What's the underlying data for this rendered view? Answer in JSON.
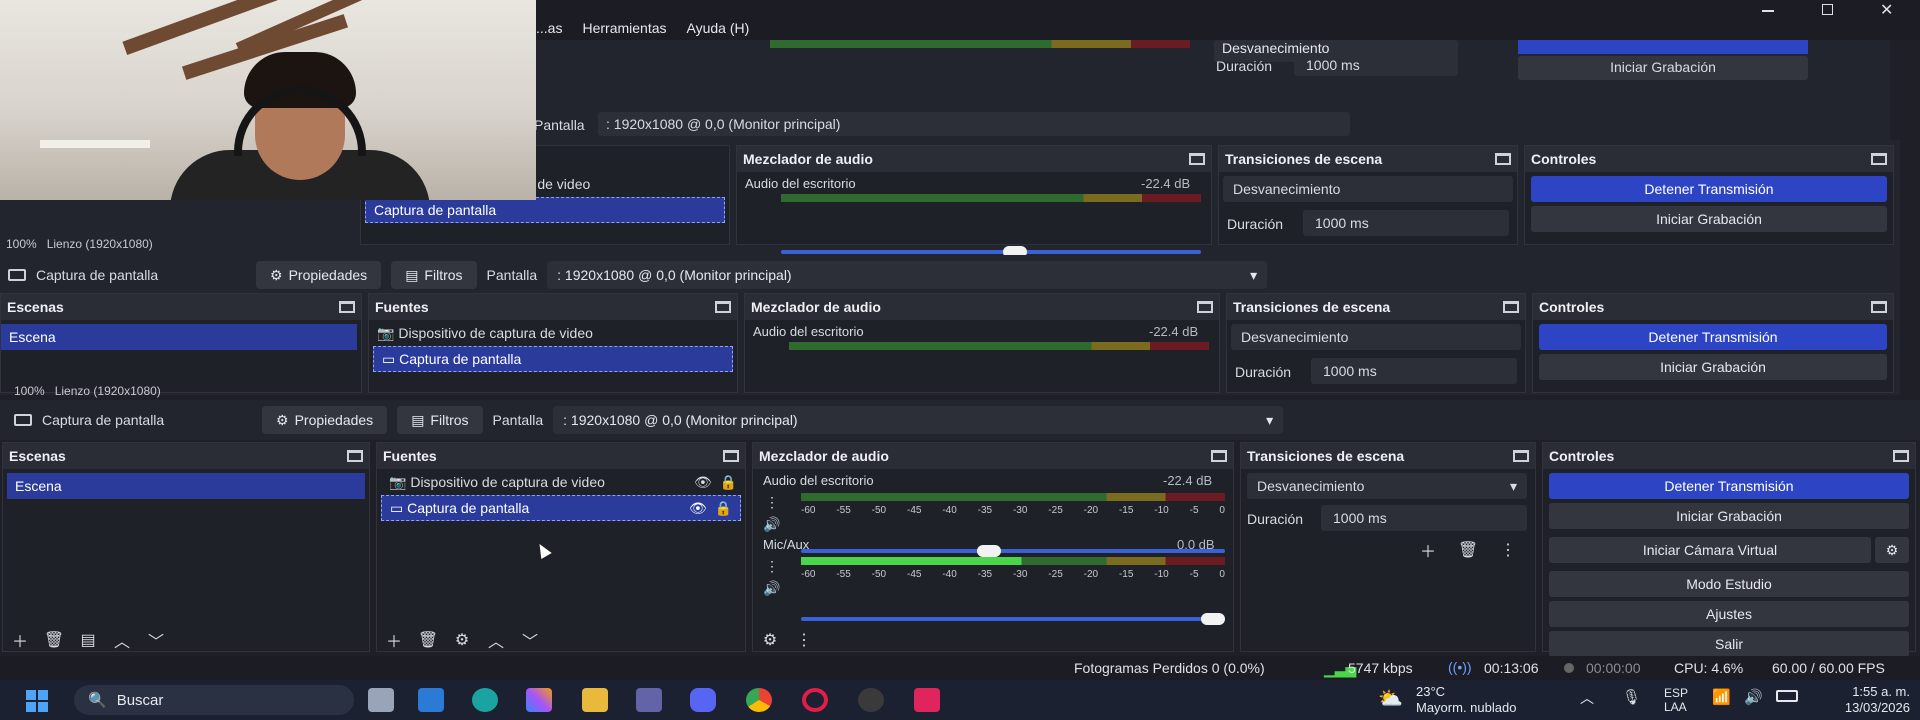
{
  "menu": {
    "items": [
      "...as",
      "Herramientas",
      "Ayuda (H)"
    ]
  },
  "source_toolbar": {
    "source_name": "Captura de pantalla",
    "properties": "Propiedades",
    "filters": "Filtros",
    "display_label": "Pantalla",
    "display_value": ": 1920x1080 @ 0,0 (Monitor principal)"
  },
  "preview": {
    "zoom": "100%",
    "canvas": "Lienzo (1920x1080)"
  },
  "scenes": {
    "title": "Escenas",
    "items": [
      "Escena"
    ]
  },
  "sources": {
    "title": "Fuentes",
    "items": [
      "Dispositivo de captura de video",
      "Captura de pantalla"
    ],
    "partial_item": "ra de video"
  },
  "mixer": {
    "title": "Mezclador de audio",
    "channels": [
      {
        "name": "Audio del escritorio",
        "db": "-22.4 dB"
      },
      {
        "name": "Mic/Aux",
        "db": "0.0 dB"
      }
    ],
    "scale": [
      "-60",
      "-55",
      "-50",
      "-45",
      "-40",
      "-35",
      "-30",
      "-25",
      "-20",
      "-15",
      "-10",
      "-5",
      "0"
    ]
  },
  "transitions": {
    "title": "Transiciones de escena",
    "selected": "Desvanecimiento",
    "duration_label": "Duración",
    "duration_value": "1000 ms"
  },
  "controls": {
    "title": "Controles",
    "buttons": [
      "Detener Transmisión",
      "Iniciar Grabación",
      "Iniciar Cámara Virtual",
      "Modo Estudio",
      "Ajustes",
      "Salir"
    ]
  },
  "statusbar": {
    "dropped": "Fotogramas Perdidos 0 (0.0%)",
    "bitrate": "5747 kbps",
    "stream_time": "00:13:06",
    "rec_time": "00:00:00",
    "cpu": "CPU: 4.6%",
    "fps": "60.00 / 60.00 FPS"
  },
  "taskbar": {
    "search": "Buscar",
    "weather_temp": "23°C",
    "weather_desc": "Mayorm. nublado",
    "lang_top": "ESP",
    "lang_bottom": "LAA",
    "time": "1:55 a. m.",
    "date": "13/03/2026"
  },
  "colors": {
    "accent": "#2d45c4",
    "bg": "#1f2027"
  }
}
